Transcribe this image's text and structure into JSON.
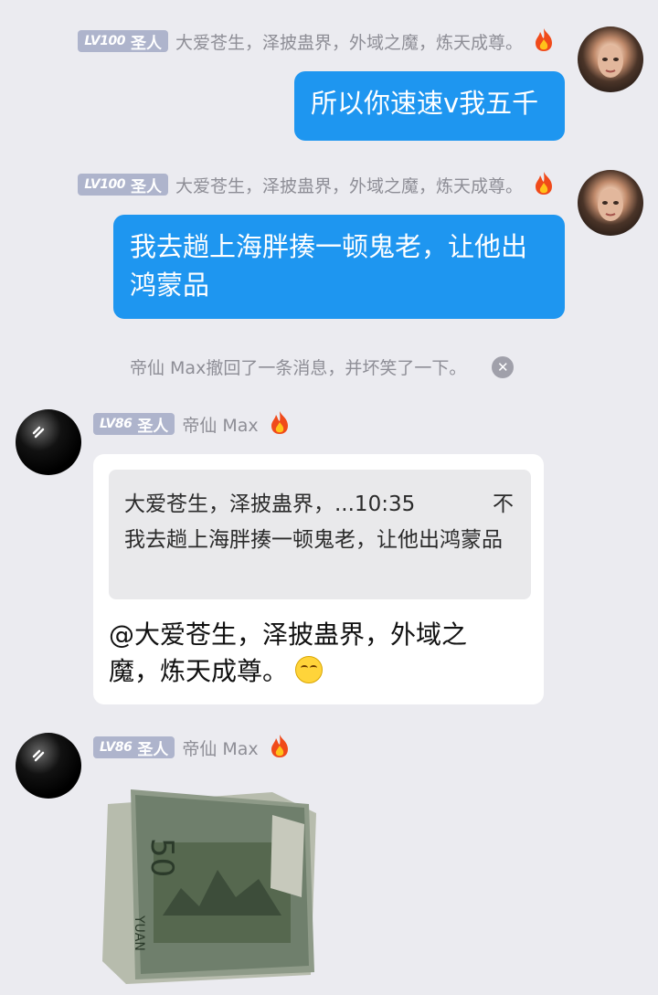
{
  "messages": [
    {
      "level": "LV100",
      "title": "圣人",
      "nickname": "大爱苍生，泽披蛊界，外域之魔，炼天成尊。",
      "text": "所以你速速v我五千",
      "avatar": "portrait-avatar"
    },
    {
      "level": "LV100",
      "title": "圣人",
      "nickname": "大爱苍生，泽披蛊界，外域之魔，炼天成尊。",
      "text": "我去趟上海胖揍一顿鬼老，让他出鸿蒙品",
      "avatar": "portrait-avatar"
    }
  ],
  "recall_notice": "帝仙 Max撤回了一条消息，并坏笑了一下。",
  "reply": {
    "level": "LV86",
    "title": "圣人",
    "nickname": "帝仙 Max",
    "quote_header": "大爱苍生，泽披蛊界，...10:35",
    "quote_icon": "不",
    "quote_text": "我去趟上海胖揍一顿鬼老，让他出鸿蒙品",
    "text": "@大爱苍生，泽披蛊界，外域之魔，炼天成尊。",
    "emoji": "smirk-emoji"
  },
  "image_message": {
    "level": "LV86",
    "title": "圣人",
    "nickname": "帝仙 Max",
    "banknote_text": "50 YUAN"
  },
  "colors": {
    "background": "#ebebf0",
    "blue_bubble": "#1e96f0",
    "level_badge": "#aeb4cc"
  }
}
